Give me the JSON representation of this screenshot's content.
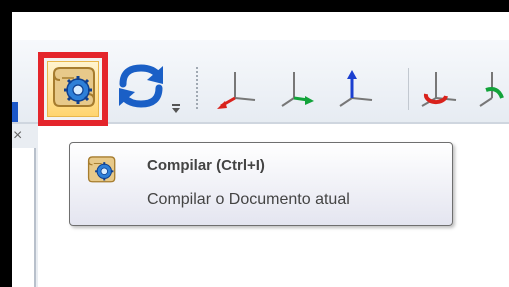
{
  "tooltip": {
    "title": "Compilar (Ctrl+I)",
    "description": "Compilar o Documento atual"
  },
  "panel": {
    "close_glyph": "×"
  },
  "icons": {
    "compile": "scroll-gear-icon",
    "refresh": "refresh-arrows-icon",
    "axes": [
      "axis-red-x-icon",
      "axis-green-y-icon",
      "axis-blue-z-icon",
      "axis-rotate-red-icon",
      "axis-rotate-green-icon"
    ]
  },
  "colors": {
    "highlight": "#e4252b",
    "button_active": "#ffd46e",
    "axis_red": "#d9221c",
    "axis_green": "#12a33a",
    "axis_blue": "#1b3fd0"
  }
}
